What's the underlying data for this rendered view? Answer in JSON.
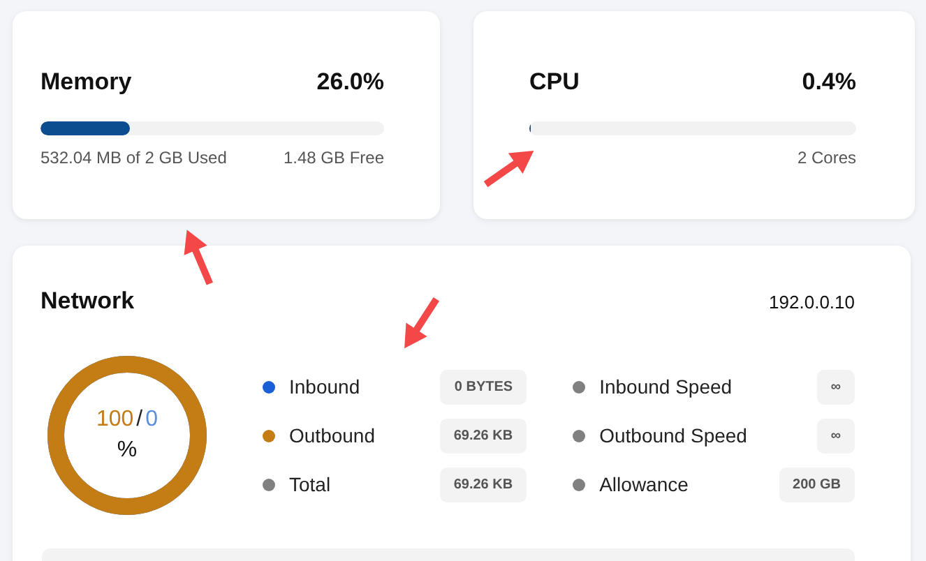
{
  "memory": {
    "title": "Memory",
    "percent": "26.0%",
    "level": 0.26,
    "used": "532.04 MB of 2 GB Used",
    "free": "1.48 GB Free"
  },
  "cpu": {
    "title": "CPU",
    "percent": "0.4%",
    "level": 0.004,
    "cores": "2 Cores"
  },
  "network": {
    "title": "Network",
    "ip": "192.0.0.10",
    "donut": {
      "level": 1,
      "outbound": "100",
      "separator": "/",
      "inbound": "0",
      "unit": "%"
    },
    "stats_left": [
      {
        "label": "Inbound",
        "value": "0 BYTES",
        "color": "#1a5fd6"
      },
      {
        "label": "Outbound",
        "value": "69.26 KB",
        "color": "#c47d14"
      },
      {
        "label": "Total",
        "value": "69.26 KB",
        "color": "#808080"
      }
    ],
    "stats_right": [
      {
        "label": "Inbound Speed",
        "value": "∞",
        "color": "#808080"
      },
      {
        "label": "Outbound Speed",
        "value": "∞",
        "color": "#808080"
      },
      {
        "label": "Allowance",
        "value": "200 GB",
        "color": "#808080"
      }
    ]
  },
  "annotation_arrows": [
    {
      "kind": "arrow"
    },
    {
      "kind": "arrow"
    },
    {
      "kind": "arrow"
    }
  ]
}
